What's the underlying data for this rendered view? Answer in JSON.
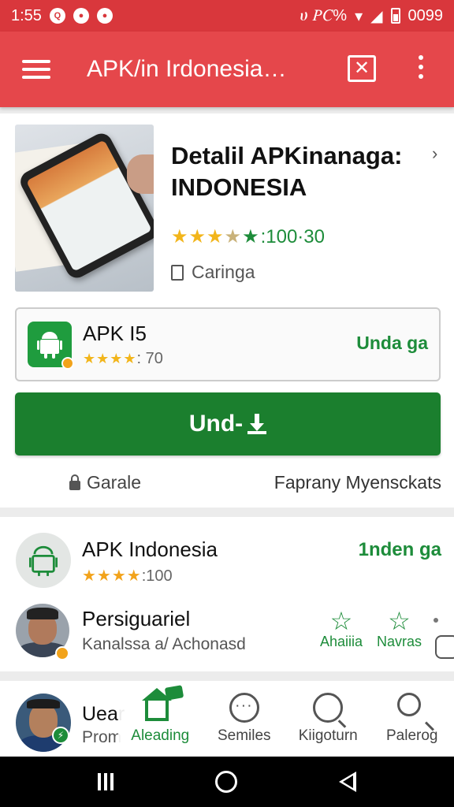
{
  "status_bar": {
    "time": "1:55",
    "right_text": "ሀ 𝑃𝐶%",
    "battery_text": "0099",
    "colors": {
      "background": "#d9373c"
    }
  },
  "app_bar": {
    "title": "APK/in Irdonesia…",
    "close_icon": "x-box-icon",
    "menu_icon": "hamburger-icon",
    "more_icon": "kebab-icon",
    "colors": {
      "background": "#e5474b"
    }
  },
  "detail": {
    "title": "Detalil APKinanaga: INDONESIA",
    "rating_text": ":100·30",
    "stars": "★★★",
    "partial_stars": "★",
    "green_star": "★",
    "developer": "Caringa"
  },
  "apk_box": {
    "name": "APK I5",
    "stars": "★★★★",
    "rating": ": 70",
    "action_label": "Unda ga"
  },
  "download_button": {
    "label": "Und-",
    "icon": "download-icon",
    "color": "#1b7f2e"
  },
  "info_row": {
    "left_label": "Garale",
    "right_label": "Faprany Myensckats"
  },
  "list": {
    "item1": {
      "name": "APK Indonesia",
      "stars": "★★★★",
      "rating": ":100",
      "action_label": "1nden ga"
    },
    "item2": {
      "name": "Persiguariel",
      "subtitle": "Kanalssa a/ Achonasd",
      "fav1_label": "Ahaiiia",
      "fav2_label": "Navras"
    },
    "item3": {
      "name": "Uear",
      "subtitle": "Prom"
    }
  },
  "bottom_nav": {
    "items": [
      {
        "label": "Aleading",
        "icon": "home-flag-icon",
        "active": true
      },
      {
        "label": "Semiles",
        "icon": "reel-icon",
        "active": false
      },
      {
        "label": "Kiigoturn",
        "icon": "face-search-icon",
        "active": false
      },
      {
        "label": "Palerog",
        "icon": "search-icon",
        "active": false
      }
    ]
  },
  "colors": {
    "accent_green": "#1d8c3a",
    "star_yellow": "#f2b51b"
  }
}
